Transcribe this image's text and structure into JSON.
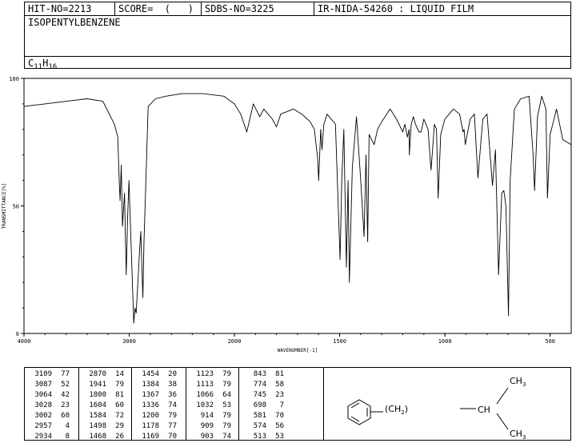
{
  "header": {
    "hit_no": "HIT-NO=2213",
    "score": "SCORE=  (   )",
    "sdbs_no": "SDBS-NO=3225",
    "method": "IR-NIDA-54260 : LIQUID FILM",
    "compound_name": "ISOPENTYLBENZENE",
    "formula_c": "C",
    "formula_c_sub": "11",
    "formula_h": "H",
    "formula_h_sub": "16"
  },
  "chart_data": {
    "type": "line",
    "xlabel": "WAVENUMBER[-1]",
    "ylabel": "TRANSMITTANCE[%]",
    "xlim": [
      4000,
      400
    ],
    "ylim": [
      0,
      100
    ],
    "x_ticks": [
      "4000",
      "3000",
      "2000",
      "1500",
      "1000",
      "500"
    ],
    "y_ticks": [
      "0",
      "50",
      "100"
    ],
    "series": [
      {
        "x": [
          4000,
          3800,
          3600,
          3400,
          3250,
          3140,
          3109,
          3095,
          3087,
          3075,
          3064,
          3045,
          3028,
          3015,
          3002,
          2990,
          2957,
          2945,
          2934,
          2920,
          2900,
          2890,
          2870,
          2860,
          2820,
          2750,
          2650,
          2500,
          2300,
          2100,
          2000,
          1970,
          1941,
          1910,
          1880,
          1860,
          1820,
          1800,
          1780,
          1720,
          1680,
          1640,
          1620,
          1604,
          1600,
          1590,
          1584,
          1575,
          1560,
          1520,
          1498,
          1490,
          1480,
          1468,
          1460,
          1454,
          1440,
          1420,
          1400,
          1384,
          1375,
          1367,
          1360,
          1336,
          1320,
          1300,
          1260,
          1230,
          1200,
          1190,
          1178,
          1170,
          1169,
          1160,
          1150,
          1140,
          1123,
          1113,
          1100,
          1080,
          1066,
          1050,
          1040,
          1032,
          1020,
          1000,
          960,
          930,
          914,
          909,
          903,
          880,
          860,
          843,
          820,
          800,
          774,
          760,
          745,
          730,
          720,
          710,
          698,
          690,
          670,
          640,
          600,
          581,
          574,
          560,
          540,
          520,
          513,
          500,
          470,
          440,
          400
        ],
        "values": [
          89,
          90,
          91,
          92,
          91,
          82,
          77,
          60,
          52,
          66,
          42,
          55,
          23,
          45,
          60,
          45,
          4,
          10,
          8,
          18,
          34,
          40,
          14,
          35,
          89,
          92,
          93,
          94,
          94,
          93,
          90,
          86,
          79,
          90,
          85,
          88,
          84,
          81,
          86,
          88,
          86,
          83,
          80,
          68,
          60,
          80,
          72,
          82,
          86,
          82,
          29,
          60,
          80,
          26,
          60,
          20,
          65,
          85,
          60,
          38,
          70,
          36,
          78,
          74,
          80,
          83,
          88,
          84,
          79,
          82,
          77,
          80,
          70,
          82,
          85,
          82,
          79,
          79,
          84,
          80,
          64,
          82,
          80,
          53,
          78,
          84,
          88,
          86,
          79,
          80,
          74,
          84,
          86,
          61,
          84,
          86,
          58,
          72,
          23,
          55,
          56,
          50,
          7,
          60,
          88,
          92,
          93,
          70,
          56,
          85,
          93,
          88,
          53,
          78,
          88,
          76,
          74
        ]
      }
    ],
    "peaks": [
      [
        "3109",
        "77"
      ],
      [
        "3087",
        "52"
      ],
      [
        "3064",
        "42"
      ],
      [
        "3028",
        "23"
      ],
      [
        "3002",
        "60"
      ],
      [
        "2957",
        "4"
      ],
      [
        "2934",
        "8"
      ],
      [
        "2870",
        "14"
      ],
      [
        "1941",
        "79"
      ],
      [
        "1800",
        "81"
      ],
      [
        "1604",
        "60"
      ],
      [
        "1584",
        "72"
      ],
      [
        "1498",
        "29"
      ],
      [
        "1468",
        "26"
      ],
      [
        "1454",
        "20"
      ],
      [
        "1384",
        "38"
      ],
      [
        "1367",
        "36"
      ],
      [
        "1336",
        "74"
      ],
      [
        "1200",
        "79"
      ],
      [
        "1178",
        "77"
      ],
      [
        "1169",
        "70"
      ],
      [
        "1123",
        "79"
      ],
      [
        "1113",
        "79"
      ],
      [
        "1066",
        "64"
      ],
      [
        "1032",
        "53"
      ],
      [
        "914",
        "79"
      ],
      [
        "909",
        "79"
      ],
      [
        "903",
        "74"
      ],
      [
        "843",
        "81"
      ],
      [
        "774",
        "58"
      ],
      [
        "745",
        "23"
      ],
      [
        "698",
        "7"
      ],
      [
        "581",
        "70"
      ],
      [
        "574",
        "56"
      ],
      [
        "513",
        "53"
      ]
    ]
  },
  "structure": {
    "chain_left": "(CH",
    "chain_sub": "2",
    "chain_sub2": "2",
    "chain_right": ")",
    "ch": "CH",
    "ch3_top": "CH",
    "ch3_top_sub": "3",
    "ch3_bottom": "CH",
    "ch3_bottom_sub": "3"
  },
  "colors": {
    "line": "#000000",
    "background": "#ffffff"
  }
}
